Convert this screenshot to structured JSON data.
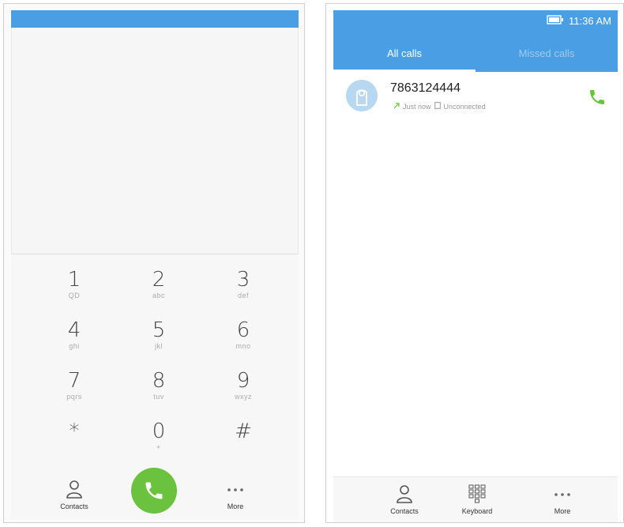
{
  "left_phone": {
    "keypad": [
      {
        "digit": "1",
        "letters": "QD"
      },
      {
        "digit": "2",
        "letters": "abc"
      },
      {
        "digit": "3",
        "letters": "def"
      },
      {
        "digit": "4",
        "letters": "ghi"
      },
      {
        "digit": "5",
        "letters": "jkl"
      },
      {
        "digit": "6",
        "letters": "mno"
      },
      {
        "digit": "7",
        "letters": "pqrs"
      },
      {
        "digit": "8",
        "letters": "tuv"
      },
      {
        "digit": "9",
        "letters": "wxyz"
      },
      {
        "digit": "*",
        "letters": ""
      },
      {
        "digit": "0",
        "letters": "+"
      },
      {
        "digit": "#",
        "letters": ""
      }
    ],
    "bottom": {
      "contacts_label": "Contacts",
      "more_label": "More"
    },
    "icons": {
      "call": "phone-icon",
      "contacts": "person-icon",
      "more": "more-dots-icon"
    }
  },
  "right_phone": {
    "status": {
      "time": "11:36 AM"
    },
    "tabs": [
      {
        "label": "All calls",
        "active": true
      },
      {
        "label": "Missed calls",
        "active": false
      }
    ],
    "calls": [
      {
        "number": "7863124444",
        "time": "Just now",
        "status": "Unconnected"
      }
    ],
    "bottom": {
      "contacts_label": "Contacts",
      "keyboard_label": "Keyboard",
      "more_label": "More"
    }
  },
  "colors": {
    "accent": "#4a9fe4",
    "call_green": "#6ac23e"
  }
}
